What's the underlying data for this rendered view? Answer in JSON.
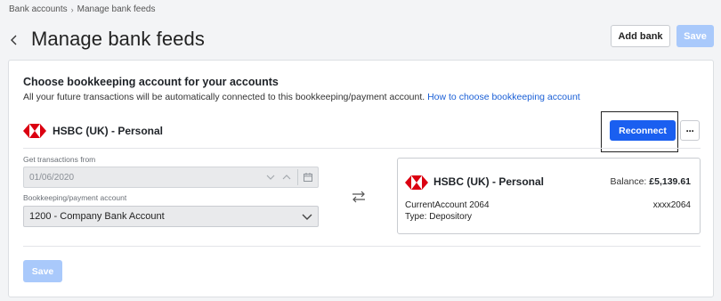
{
  "breadcrumb": {
    "items": [
      "Bank accounts",
      "Manage bank feeds"
    ],
    "separator": "›"
  },
  "header": {
    "title": "Manage bank feeds",
    "add_bank_label": "Add bank",
    "save_label": "Save"
  },
  "card": {
    "heading": "Choose bookkeeping account for your accounts",
    "description": "All your future transactions will be automatically connected to this bookkeeping/payment account.",
    "help_link": "How to choose bookkeeping account",
    "bank_name": "HSBC (UK) - Personal",
    "reconnect_label": "Reconnect",
    "more_label": "···",
    "get_transactions_label": "Get transactions from",
    "get_transactions_value": "01/06/2020",
    "bookkeeping_label": "Bookkeeping/payment account",
    "bookkeeping_value": "1200 - Company Bank Account",
    "save_label": "Save"
  },
  "account_detail": {
    "name": "HSBC (UK) - Personal",
    "balance_label": "Balance:",
    "balance_value": "£5,139.61",
    "account_name": "CurrentAccount 2064",
    "account_number": "xxxx2064",
    "type": "Type: Depository"
  },
  "colors": {
    "primary": "#1a5ff0",
    "disabled": "#a9c9fb",
    "link": "#1a5fd6",
    "hsbc_red": "#db0011"
  }
}
